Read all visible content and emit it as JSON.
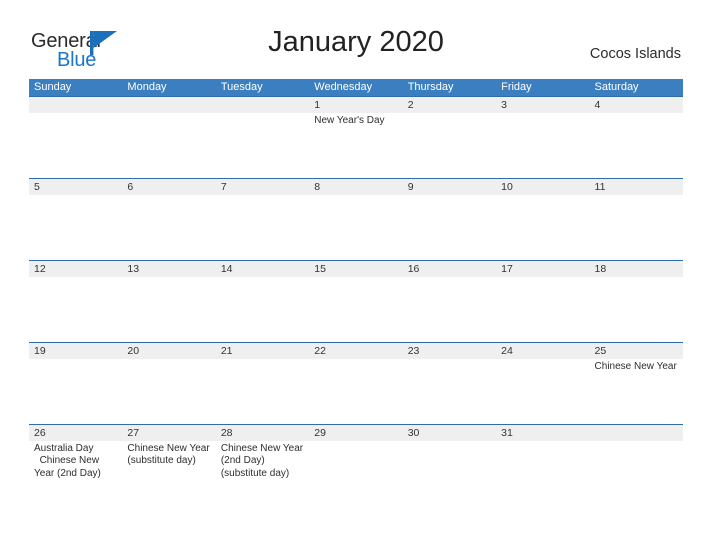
{
  "brand": {
    "name_primary": "General",
    "name_secondary": "Blue",
    "flag_icon": "flag-triangle-icon",
    "primary_color": "#2b2b2b",
    "secondary_color": "#1b76c7"
  },
  "header": {
    "title": "January 2020",
    "location": "Cocos Islands"
  },
  "theme": {
    "header_blue": "#3c7fc0",
    "separator_blue": "#2f6ca8",
    "date_band_gray": "#efefef",
    "text_color": "#2e2e2e"
  },
  "calendar": {
    "weekdays": [
      "Sunday",
      "Monday",
      "Tuesday",
      "Wednesday",
      "Thursday",
      "Friday",
      "Saturday"
    ],
    "weeks": [
      {
        "dates": [
          "",
          "",
          "",
          "1",
          "2",
          "3",
          "4"
        ],
        "events": [
          "",
          "",
          "",
          "New Year's Day",
          "",
          "",
          ""
        ]
      },
      {
        "dates": [
          "5",
          "6",
          "7",
          "8",
          "9",
          "10",
          "11"
        ],
        "events": [
          "",
          "",
          "",
          "",
          "",
          "",
          ""
        ]
      },
      {
        "dates": [
          "12",
          "13",
          "14",
          "15",
          "16",
          "17",
          "18"
        ],
        "events": [
          "",
          "",
          "",
          "",
          "",
          "",
          ""
        ]
      },
      {
        "dates": [
          "19",
          "20",
          "21",
          "22",
          "23",
          "24",
          "25"
        ],
        "events": [
          "",
          "",
          "",
          "",
          "",
          "",
          "Chinese New Year"
        ]
      },
      {
        "dates": [
          "26",
          "27",
          "28",
          "29",
          "30",
          "31",
          ""
        ],
        "events": [
          "Australia Day\n  Chinese New Year (2nd Day)",
          "Chinese New Year (substitute day)",
          "Chinese New Year (2nd Day) (substitute day)",
          "",
          "",
          "",
          ""
        ]
      }
    ]
  }
}
